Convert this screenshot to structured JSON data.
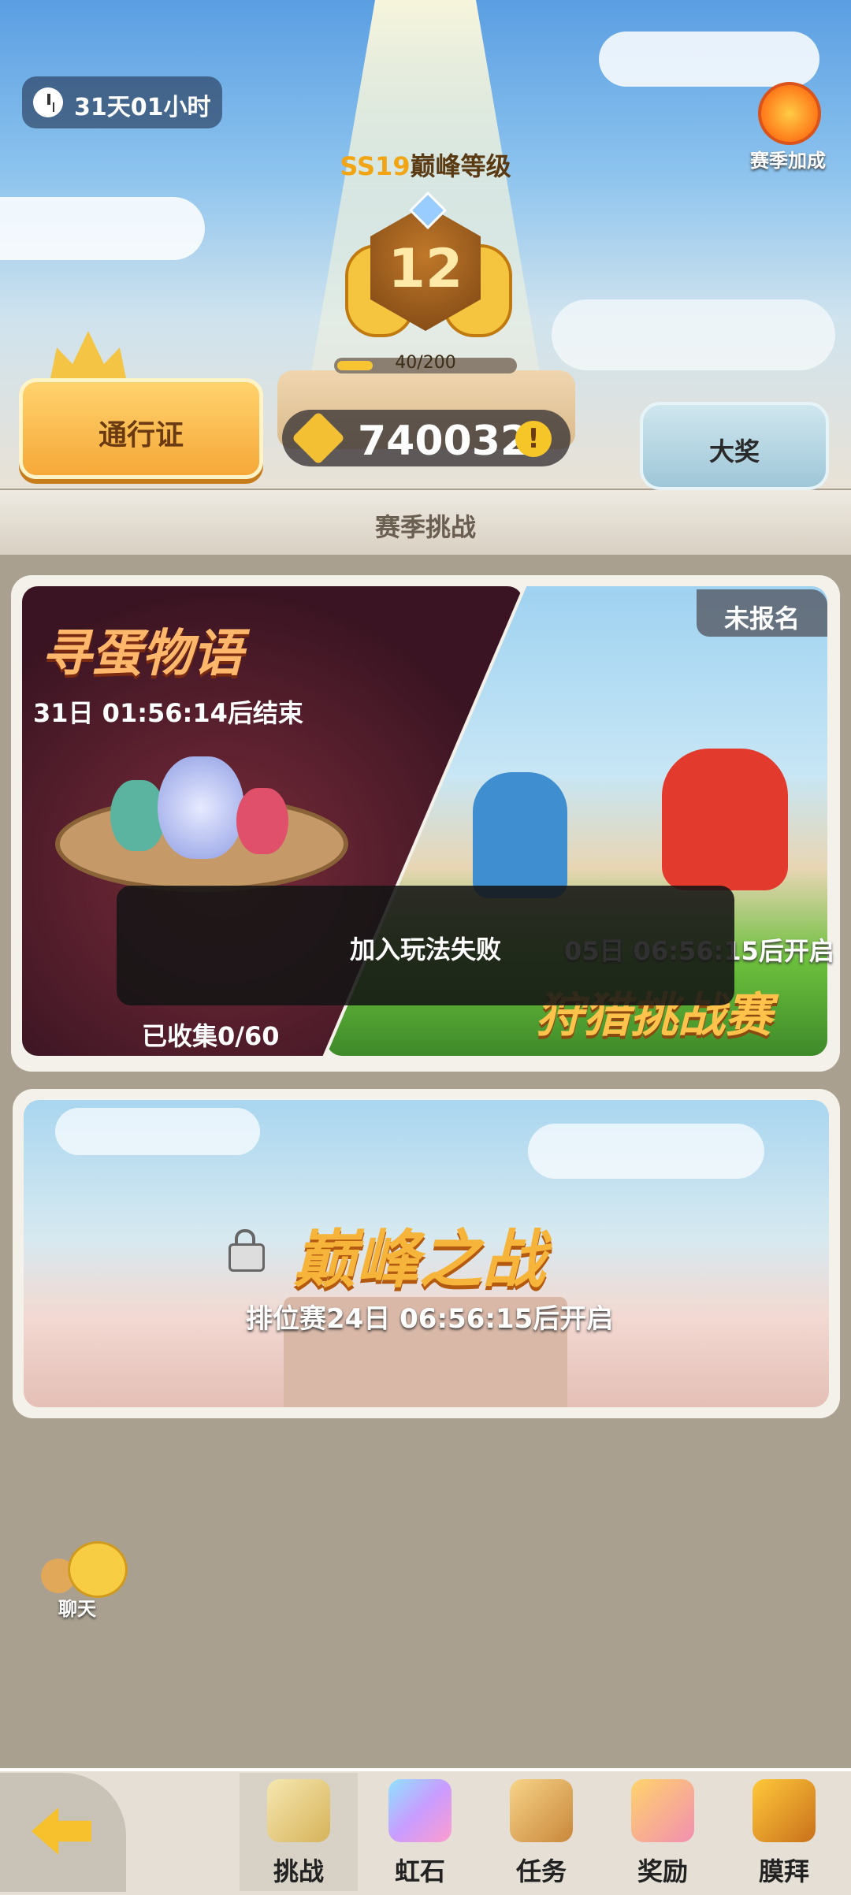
{
  "header": {
    "countdown": "31天01小时",
    "season_bonus_label": "赛季加成",
    "peak_level_season": "SS19",
    "peak_level_label": "巅峰等级",
    "level": "12",
    "xp_text": "40/200",
    "xp_progress": 0.2,
    "pass_button": "通行证",
    "coins": "740032",
    "prize_button": "大奖"
  },
  "section_title": "赛季挑战",
  "cards": {
    "egg": {
      "title": "寻蛋物语",
      "timer": "31日 01:56:14后结束",
      "collected": "已收集0/60"
    },
    "hunt": {
      "status": "未报名",
      "start_time": "05日 06:56:15后开启",
      "title": "狩猎挑战赛"
    },
    "peak": {
      "title": "巅峰之战",
      "subtitle": "排位赛24日 06:56:15后开启"
    }
  },
  "toast": "加入玩法失败",
  "chat_label": "聊天",
  "tabs": [
    {
      "label": "挑战",
      "active": true
    },
    {
      "label": "虹石"
    },
    {
      "label": "任务"
    },
    {
      "label": "奖励"
    },
    {
      "label": "膜拜"
    }
  ]
}
